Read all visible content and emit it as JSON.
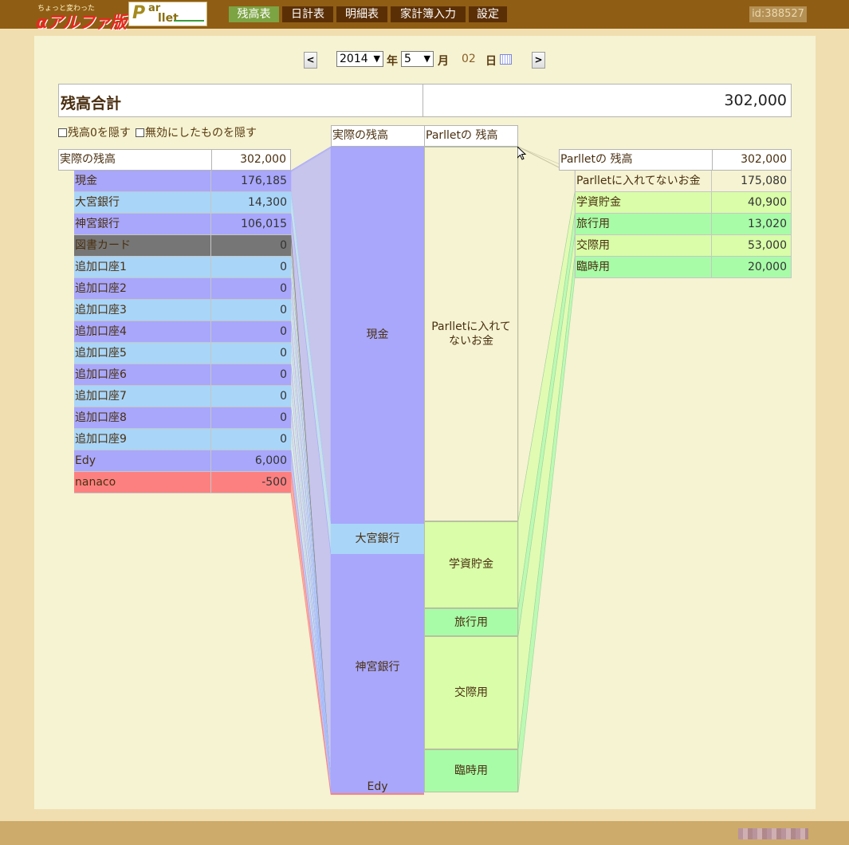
{
  "header": {
    "logo_small": "ちょっと変わった",
    "logo_big": "αアルファ版",
    "logo2_p": "P",
    "logo2_t1": "ar",
    "logo2_t2": "llet",
    "nav": [
      "残高表",
      "日計表",
      "明細表",
      "家計簿入力",
      "設定"
    ],
    "active_nav": "残高表",
    "user_id": "id:388527"
  },
  "date": {
    "prev_label": "<",
    "next_label": ">",
    "year": "2014",
    "year_suffix": "年",
    "month": "5",
    "month_suffix": "月",
    "day": "02",
    "day_suffix": "日",
    "calendar_icon": "calendar-icon"
  },
  "total": {
    "title": "残高合計",
    "value": "302,000"
  },
  "options": {
    "hide_zero": "残高0を隠す",
    "hide_disabled": "無効にしたものを隠す"
  },
  "actual": {
    "header_label": "実際の残高",
    "header_value": "302,000",
    "rows": [
      {
        "label": "現金",
        "value": "176,185",
        "amount": 176185,
        "color": "#a8a7fc"
      },
      {
        "label": "大宮銀行",
        "value": "14,300",
        "amount": 14300,
        "color": "#a9d5f8"
      },
      {
        "label": "神宮銀行",
        "value": "106,015",
        "amount": 106015,
        "color": "#a8a7fc"
      },
      {
        "label": "図書カード",
        "value": "0",
        "amount": 0,
        "color": "#767676"
      },
      {
        "label": "追加口座1",
        "value": "0",
        "amount": 0,
        "color": "#a9d5f8"
      },
      {
        "label": "追加口座2",
        "value": "0",
        "amount": 0,
        "color": "#a8a7fc"
      },
      {
        "label": "追加口座3",
        "value": "0",
        "amount": 0,
        "color": "#a9d5f8"
      },
      {
        "label": "追加口座4",
        "value": "0",
        "amount": 0,
        "color": "#a8a7fc"
      },
      {
        "label": "追加口座5",
        "value": "0",
        "amount": 0,
        "color": "#a9d5f8"
      },
      {
        "label": "追加口座6",
        "value": "0",
        "amount": 0,
        "color": "#a8a7fc"
      },
      {
        "label": "追加口座7",
        "value": "0",
        "amount": 0,
        "color": "#a9d5f8"
      },
      {
        "label": "追加口座8",
        "value": "0",
        "amount": 0,
        "color": "#a8a7fc"
      },
      {
        "label": "追加口座9",
        "value": "0",
        "amount": 0,
        "color": "#a9d5f8"
      },
      {
        "label": "Edy",
        "value": "6,000",
        "amount": 6000,
        "color": "#a8a7fc"
      },
      {
        "label": "nanaco",
        "value": "-500",
        "amount": -500,
        "color": "#fd8080"
      }
    ]
  },
  "parllet": {
    "header_label": "Parlletの 残高",
    "header_value": "302,000",
    "rows": [
      {
        "label": "Parlletに入れてないお金",
        "value": "175,080",
        "amount": 175080,
        "color": "#f5f3d2"
      },
      {
        "label": "学資貯金",
        "value": "40,900",
        "amount": 40900,
        "color": "#d9fda8"
      },
      {
        "label": "旅行用",
        "value": "13,020",
        "amount": 13020,
        "color": "#a8fca8"
      },
      {
        "label": "交際用",
        "value": "53,000",
        "amount": 53000,
        "color": "#d9fda8"
      },
      {
        "label": "臨時用",
        "value": "20,000",
        "amount": 20000,
        "color": "#a8fca8"
      }
    ]
  },
  "chart_data": {
    "type": "bar",
    "title": "",
    "columns": [
      {
        "name": "実際の残高",
        "segments": [
          {
            "label": "現金",
            "value": 176185
          },
          {
            "label": "大宮銀行",
            "value": 14300
          },
          {
            "label": "神宮銀行",
            "value": 106015
          },
          {
            "label": "Edy",
            "value": 6000
          },
          {
            "label": "nanaco",
            "value": -500
          }
        ]
      },
      {
        "name": "Parlletの 残高",
        "segments": [
          {
            "label": "Parlletに入れてないお金",
            "value": 175080
          },
          {
            "label": "学資貯金",
            "value": 40900
          },
          {
            "label": "旅行用",
            "value": 13020
          },
          {
            "label": "交際用",
            "value": 53000
          },
          {
            "label": "臨時用",
            "value": 20000
          }
        ]
      }
    ],
    "total": 302000
  }
}
